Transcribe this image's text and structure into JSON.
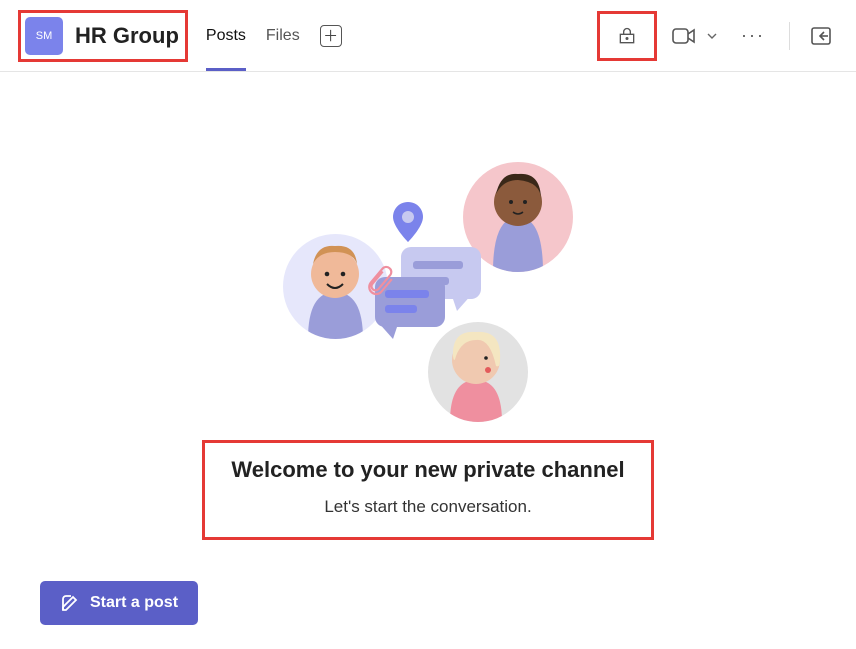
{
  "header": {
    "avatar_initials": "SM",
    "title": "HR Group",
    "tabs": [
      {
        "label": "Posts",
        "active": true
      },
      {
        "label": "Files",
        "active": false
      }
    ]
  },
  "welcome": {
    "title": "Welcome to your new private channel",
    "subtitle": "Let's start the conversation."
  },
  "compose": {
    "start_post_label": "Start a post"
  },
  "icons": {
    "lock": "lock-icon",
    "video": "video-icon",
    "more": "more-icon",
    "panel": "panel-toggle-icon",
    "compose": "compose-icon",
    "add": "add-icon"
  }
}
